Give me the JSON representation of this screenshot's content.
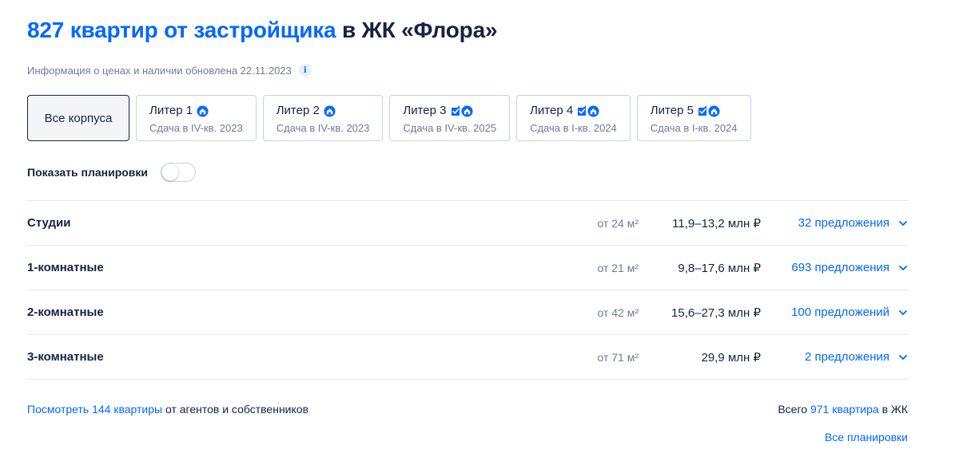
{
  "header": {
    "title_accent": "827 квартир от застройщика",
    "title_rest": " в ЖК «Флора»"
  },
  "info": {
    "text": "Информация о ценах и наличии обновлена 22.11.2023",
    "icon": "i"
  },
  "tabs": [
    {
      "name": "Все корпуса",
      "date": "",
      "icons": [],
      "selected": true
    },
    {
      "name": "Литер 1",
      "date": "Сдача в IV-кв. 2023",
      "icons": [
        "house-icon"
      ]
    },
    {
      "name": "Литер 2",
      "date": "Сдача в IV-кв. 2023",
      "icons": [
        "house-icon"
      ]
    },
    {
      "name": "Литер 3",
      "date": "Сдача в IV-кв. 2025",
      "icons": [
        "check-icon",
        "house-icon"
      ]
    },
    {
      "name": "Литер 4",
      "date": "Сдача в I-кв. 2024",
      "icons": [
        "check-icon",
        "house-icon"
      ]
    },
    {
      "name": "Литер 5",
      "date": "Сдача в I-кв. 2024",
      "icons": [
        "check-icon",
        "house-icon"
      ]
    }
  ],
  "toggle": {
    "label": "Показать планировки",
    "on": false
  },
  "rows": [
    {
      "name": "Студии",
      "area": "от 24 м²",
      "price": "11,9–13,2 млн ₽",
      "offers": "32 предложения"
    },
    {
      "name": "1-комнатные",
      "area": "от 21 м²",
      "price": "9,8–17,6 млн ₽",
      "offers": "693 предложения"
    },
    {
      "name": "2-комнатные",
      "area": "от 42 м²",
      "price": "15,6–27,3 млн ₽",
      "offers": "100 предложений"
    },
    {
      "name": "3-комнатные",
      "area": "от 71 м²",
      "price": "29,9 млн ₽",
      "offers": "2 предложения"
    }
  ],
  "footer": {
    "left_link": "Посмотреть 144 квартиры",
    "left_rest": " от агентов и собственников",
    "right_pre": "Всего ",
    "right_link": "971 квартира",
    "right_post": " в ЖК",
    "all_plans": "Все планировки"
  },
  "colors": {
    "accent": "#0468ff",
    "text": "#152242",
    "muted": "#707a95",
    "border": "#c9d1e0"
  }
}
